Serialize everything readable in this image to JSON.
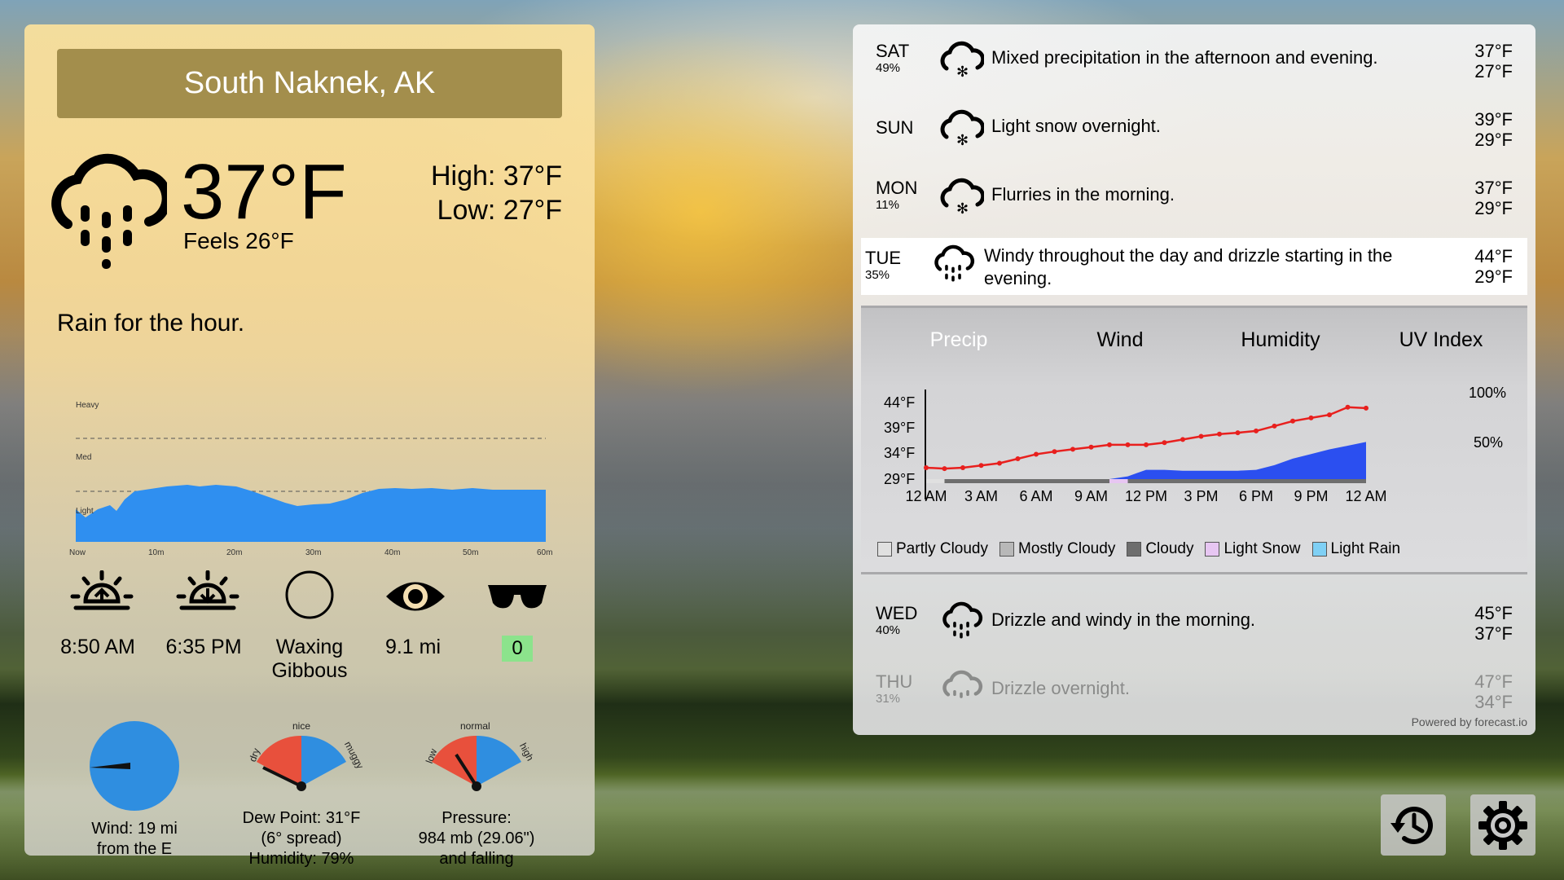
{
  "location": "South Naknek, AK",
  "current": {
    "temperature": "37°F",
    "feels_like": "Feels 26°F",
    "high": "High: 37°F",
    "low": "Low: 27°F",
    "summary": "Rain for the hour.",
    "icon": "rain-cloud-icon"
  },
  "minutely": {
    "levels": [
      "Heavy",
      "Med",
      "Light"
    ],
    "ticks": [
      "Now",
      "10m",
      "20m",
      "30m",
      "40m",
      "50m",
      "60m"
    ],
    "color": "#2f8ff0"
  },
  "stats": {
    "sunrise": "8:50 AM",
    "sunset": "6:35 PM",
    "moon_line1": "Waxing",
    "moon_line2": "Gibbous",
    "visibility": "9.1 mi",
    "uv": "0"
  },
  "gauges": {
    "wind_line1": "Wind: 19 mi",
    "wind_line2": "from the E",
    "dew_line1": "Dew Point: 31°F",
    "dew_line2": "(6° spread)",
    "dew_line3": "Humidity: 79%",
    "dew_labels": [
      "dry",
      "nice",
      "muggy"
    ],
    "press_line1": "Pressure:",
    "press_line2": "984 mb (29.06\")",
    "press_line3": "and falling",
    "press_labels": [
      "low",
      "normal",
      "high"
    ],
    "colors": {
      "low": "#e8503c",
      "high": "#2f8ee0"
    }
  },
  "daily": [
    {
      "day": "SAT",
      "pct": "49%",
      "text": "Mixed precipitation in the afternoon and evening.",
      "hi": "37°F",
      "lo": "27°F",
      "icon": "snow-cloud-icon"
    },
    {
      "day": "SUN",
      "pct": "",
      "text": "Light snow overnight.",
      "hi": "39°F",
      "lo": "29°F",
      "icon": "snow-cloud-icon"
    },
    {
      "day": "MON",
      "pct": "11%",
      "text": "Flurries in the morning.",
      "hi": "37°F",
      "lo": "29°F",
      "icon": "snow-cloud-icon"
    },
    {
      "day": "TUE",
      "pct": "35%",
      "text_line1": "Windy throughout the day and drizzle starting in the",
      "text_line2": "evening.",
      "hi": "44°F",
      "lo": "29°F",
      "icon": "rain-cloud-icon"
    },
    {
      "day": "WED",
      "pct": "40%",
      "text": "Drizzle and windy in the morning.",
      "hi": "45°F",
      "lo": "37°F",
      "icon": "rain-cloud-icon"
    },
    {
      "day": "THU",
      "pct": "31%",
      "text": "Drizzle overnight.",
      "hi": "47°F",
      "lo": "34°F",
      "icon": "rain-cloud-icon"
    }
  ],
  "detail_chart": {
    "tabs": [
      "Precip",
      "Wind",
      "Humidity",
      "UV Index"
    ],
    "active_tab": "Precip",
    "y_left": [
      "44°F",
      "39°F",
      "34°F",
      "29°F"
    ],
    "y_right": [
      "100%",
      "50%"
    ],
    "x_ticks": [
      "12 AM",
      "3 AM",
      "6 AM",
      "9 AM",
      "12 PM",
      "3 PM",
      "6 PM",
      "9 PM",
      "12 AM"
    ],
    "legend": [
      {
        "label": "Partly Cloudy",
        "color": "#e0e0e0"
      },
      {
        "label": "Mostly Cloudy",
        "color": "#b8b8b8"
      },
      {
        "label": "Cloudy",
        "color": "#6e6e6e"
      },
      {
        "label": "Light Snow",
        "color": "#e7c6f2"
      },
      {
        "label": "Light Rain",
        "color": "#7fd0f5"
      }
    ],
    "temp_color": "#e8201e",
    "precip_color": "#2b4ff0"
  },
  "chart_data": {
    "type": "line",
    "title": "",
    "x": [
      "12 AM",
      "1 AM",
      "2 AM",
      "3 AM",
      "4 AM",
      "5 AM",
      "6 AM",
      "7 AM",
      "8 AM",
      "9 AM",
      "10 AM",
      "11 AM",
      "12 PM",
      "1 PM",
      "2 PM",
      "3 PM",
      "4 PM",
      "5 PM",
      "6 PM",
      "7 PM",
      "8 PM",
      "9 PM",
      "10 PM",
      "11 PM",
      "12 AM"
    ],
    "series": [
      {
        "name": "",
        "axis": "left",
        "unit": "°F",
        "values": [
          30,
          29.8,
          30,
          30.5,
          31,
          32,
          33,
          33.6,
          34.1,
          34.6,
          35.1,
          35.1,
          35.1,
          35.6,
          36.3,
          37,
          37.5,
          37.8,
          38.2,
          39.3,
          40.4,
          41.1,
          41.8,
          43.5,
          43.3
        ]
      },
      {
        "name": "",
        "axis": "right",
        "unit": "%",
        "values": [
          0,
          0,
          0,
          0,
          0,
          0,
          0,
          0,
          0,
          0,
          0,
          3,
          10,
          10,
          9,
          9,
          9,
          9,
          10,
          15,
          22,
          27,
          32,
          36,
          40
        ]
      }
    ],
    "ylim_left": [
      26,
      46
    ],
    "ylim_right": [
      0,
      100
    ]
  },
  "powered_by": "Powered by forecast.io",
  "buttons": {
    "history": "history-icon",
    "settings": "gear-icon"
  }
}
